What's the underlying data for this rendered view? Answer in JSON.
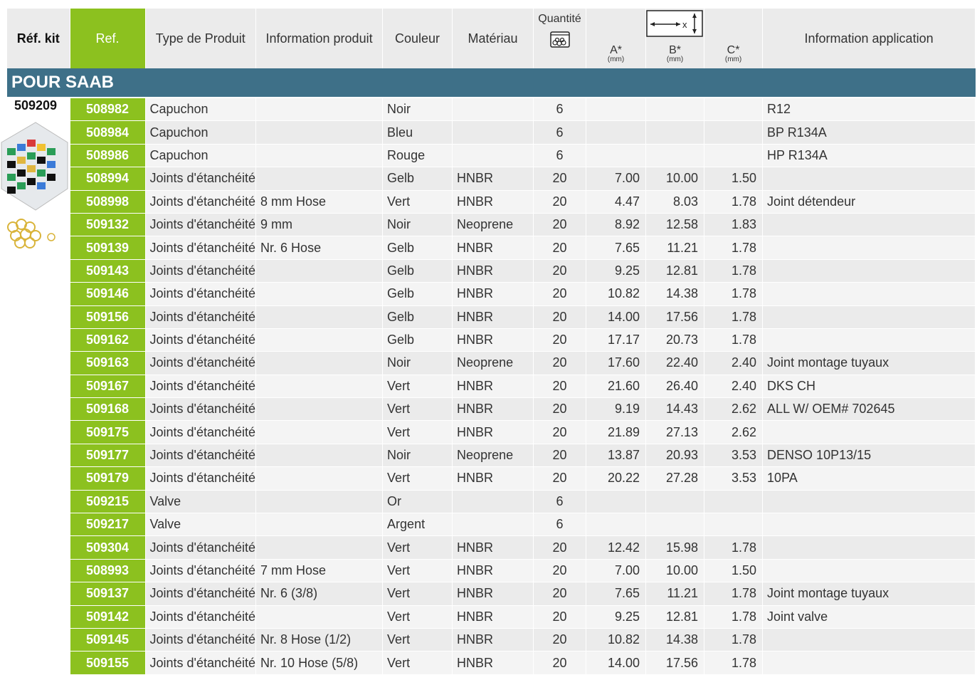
{
  "headers": {
    "ref_kit": "Réf. kit",
    "ref": "Ref.",
    "type": "Type de Produit",
    "info_produit": "Information produit",
    "couleur": "Couleur",
    "materiau": "Matériau",
    "quantite": "Quantité",
    "a": "A*",
    "b": "B*",
    "c": "C*",
    "unit": "(mm)",
    "info_application": "Information application",
    "dim_icon_x": "x"
  },
  "section_title": "POUR SAAB",
  "kit_ref": "509209",
  "colors": {
    "accent_green": "#8cc11f",
    "section_blue": "#3e7088",
    "row_grey": "#ebebeb"
  },
  "rows": [
    {
      "ref": "508982",
      "type": "Capuchon",
      "info": "",
      "couleur": "Noir",
      "materiau": "",
      "qty": "6",
      "a": "",
      "b": "",
      "c": "",
      "app": "R12"
    },
    {
      "ref": "508984",
      "type": "Capuchon",
      "info": "",
      "couleur": "Bleu",
      "materiau": "",
      "qty": "6",
      "a": "",
      "b": "",
      "c": "",
      "app": "BP R134A"
    },
    {
      "ref": "508986",
      "type": "Capuchon",
      "info": "",
      "couleur": "Rouge",
      "materiau": "",
      "qty": "6",
      "a": "",
      "b": "",
      "c": "",
      "app": "HP R134A"
    },
    {
      "ref": "508994",
      "type": "Joints d'étanchéité",
      "info": "",
      "couleur": "Gelb",
      "materiau": "HNBR",
      "qty": "20",
      "a": "7.00",
      "b": "10.00",
      "c": "1.50",
      "app": ""
    },
    {
      "ref": "508998",
      "type": "Joints d'étanchéité",
      "info": "8 mm Hose",
      "couleur": "Vert",
      "materiau": "HNBR",
      "qty": "20",
      "a": "4.47",
      "b": "8.03",
      "c": "1.78",
      "app": "Joint détendeur"
    },
    {
      "ref": "509132",
      "type": "Joints d'étanchéité",
      "info": "9 mm",
      "couleur": "Noir",
      "materiau": "Neoprene",
      "qty": "20",
      "a": "8.92",
      "b": "12.58",
      "c": "1.83",
      "app": ""
    },
    {
      "ref": "509139",
      "type": "Joints d'étanchéité",
      "info": "Nr. 6 Hose",
      "couleur": "Gelb",
      "materiau": "HNBR",
      "qty": "20",
      "a": "7.65",
      "b": "11.21",
      "c": "1.78",
      "app": ""
    },
    {
      "ref": "509143",
      "type": "Joints d'étanchéité",
      "info": "",
      "couleur": "Gelb",
      "materiau": "HNBR",
      "qty": "20",
      "a": "9.25",
      "b": "12.81",
      "c": "1.78",
      "app": ""
    },
    {
      "ref": "509146",
      "type": "Joints d'étanchéité",
      "info": "",
      "couleur": "Gelb",
      "materiau": "HNBR",
      "qty": "20",
      "a": "10.82",
      "b": "14.38",
      "c": "1.78",
      "app": ""
    },
    {
      "ref": "509156",
      "type": "Joints d'étanchéité",
      "info": "",
      "couleur": "Gelb",
      "materiau": "HNBR",
      "qty": "20",
      "a": "14.00",
      "b": "17.56",
      "c": "1.78",
      "app": ""
    },
    {
      "ref": "509162",
      "type": "Joints d'étanchéité",
      "info": "",
      "couleur": "Gelb",
      "materiau": "HNBR",
      "qty": "20",
      "a": "17.17",
      "b": "20.73",
      "c": "1.78",
      "app": ""
    },
    {
      "ref": "509163",
      "type": "Joints d'étanchéité",
      "info": "",
      "couleur": "Noir",
      "materiau": "Neoprene",
      "qty": "20",
      "a": "17.60",
      "b": "22.40",
      "c": "2.40",
      "app": "Joint montage tuyaux"
    },
    {
      "ref": "509167",
      "type": "Joints d'étanchéité",
      "info": "",
      "couleur": "Vert",
      "materiau": "HNBR",
      "qty": "20",
      "a": "21.60",
      "b": "26.40",
      "c": "2.40",
      "app": "DKS CH"
    },
    {
      "ref": "509168",
      "type": "Joints d'étanchéité",
      "info": "",
      "couleur": "Vert",
      "materiau": "HNBR",
      "qty": "20",
      "a": "9.19",
      "b": "14.43",
      "c": "2.62",
      "app": "ALL W/ OEM# 702645"
    },
    {
      "ref": "509175",
      "type": "Joints d'étanchéité",
      "info": "",
      "couleur": "Vert",
      "materiau": "HNBR",
      "qty": "20",
      "a": "21.89",
      "b": "27.13",
      "c": "2.62",
      "app": ""
    },
    {
      "ref": "509177",
      "type": "Joints d'étanchéité",
      "info": "",
      "couleur": "Noir",
      "materiau": "Neoprene",
      "qty": "20",
      "a": "13.87",
      "b": "20.93",
      "c": "3.53",
      "app": "DENSO  10P13/15"
    },
    {
      "ref": "509179",
      "type": "Joints d'étanchéité",
      "info": "",
      "couleur": "Vert",
      "materiau": "HNBR",
      "qty": "20",
      "a": "20.22",
      "b": "27.28",
      "c": "3.53",
      "app": "10PA"
    },
    {
      "ref": "509215",
      "type": "Valve",
      "info": "",
      "couleur": "Or",
      "materiau": "",
      "qty": "6",
      "a": "",
      "b": "",
      "c": "",
      "app": ""
    },
    {
      "ref": "509217",
      "type": "Valve",
      "info": "",
      "couleur": "Argent",
      "materiau": "",
      "qty": "6",
      "a": "",
      "b": "",
      "c": "",
      "app": ""
    },
    {
      "ref": "509304",
      "type": "Joints d'étanchéité",
      "info": "",
      "couleur": "Vert",
      "materiau": "HNBR",
      "qty": "20",
      "a": "12.42",
      "b": "15.98",
      "c": "1.78",
      "app": ""
    },
    {
      "ref": "508993",
      "type": "Joints d'étanchéité",
      "info": "7 mm Hose",
      "couleur": "Vert",
      "materiau": "HNBR",
      "qty": "20",
      "a": "7.00",
      "b": "10.00",
      "c": "1.50",
      "app": ""
    },
    {
      "ref": "509137",
      "type": "Joints d'étanchéité",
      "info": "Nr. 6 (3/8)",
      "couleur": "Vert",
      "materiau": "HNBR",
      "qty": "20",
      "a": "7.65",
      "b": "11.21",
      "c": "1.78",
      "app": "Joint montage tuyaux"
    },
    {
      "ref": "509142",
      "type": "Joints d'étanchéité",
      "info": "",
      "couleur": "Vert",
      "materiau": "HNBR",
      "qty": "20",
      "a": "9.25",
      "b": "12.81",
      "c": "1.78",
      "app": "Joint valve"
    },
    {
      "ref": "509145",
      "type": "Joints d'étanchéité",
      "info": "Nr. 8 Hose (1/2)",
      "couleur": "Vert",
      "materiau": "HNBR",
      "qty": "20",
      "a": "10.82",
      "b": "14.38",
      "c": "1.78",
      "app": ""
    },
    {
      "ref": "509155",
      "type": "Joints d'étanchéité",
      "info": "Nr.  10 Hose (5/8)",
      "couleur": "Vert",
      "materiau": "HNBR",
      "qty": "20",
      "a": "14.00",
      "b": "17.56",
      "c": "1.78",
      "app": ""
    }
  ]
}
